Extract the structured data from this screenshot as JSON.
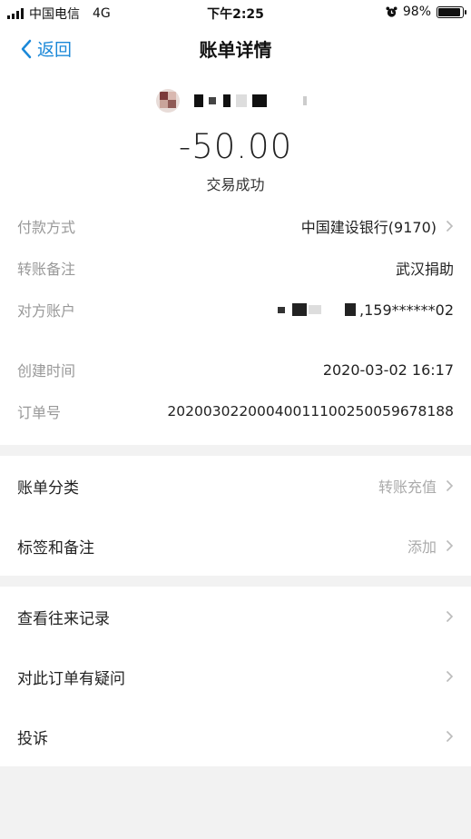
{
  "status_bar": {
    "carrier": "中国电信",
    "network": "4G",
    "time": "下午2:25",
    "battery_percent": "98%",
    "battery_level": 0.98
  },
  "nav": {
    "back_label": "返回",
    "title": "账单详情"
  },
  "summary": {
    "amount": "-50.00",
    "status": "交易成功"
  },
  "details": {
    "payment_method_label": "付款方式",
    "payment_method_value": "中国建设银行(9170)",
    "remark_label": "转账备注",
    "remark_value": "武汉捐助",
    "counterparty_label": "对方账户",
    "counterparty_value": ",159******02",
    "created_label": "创建时间",
    "created_value": "2020-03-02 16:17",
    "order_label": "订单号",
    "order_value": "20200302200040011100250059678188"
  },
  "section1": {
    "category_label": "账单分类",
    "category_value": "转账充值",
    "tags_label": "标签和备注",
    "tags_value": "添加"
  },
  "section2": {
    "history_label": "查看往来记录",
    "question_label": "对此订单有疑问",
    "complaint_label": "投诉"
  },
  "colors": {
    "accent": "#1a88d8",
    "background": "#f2f2f2",
    "muted_text": "#999999"
  }
}
